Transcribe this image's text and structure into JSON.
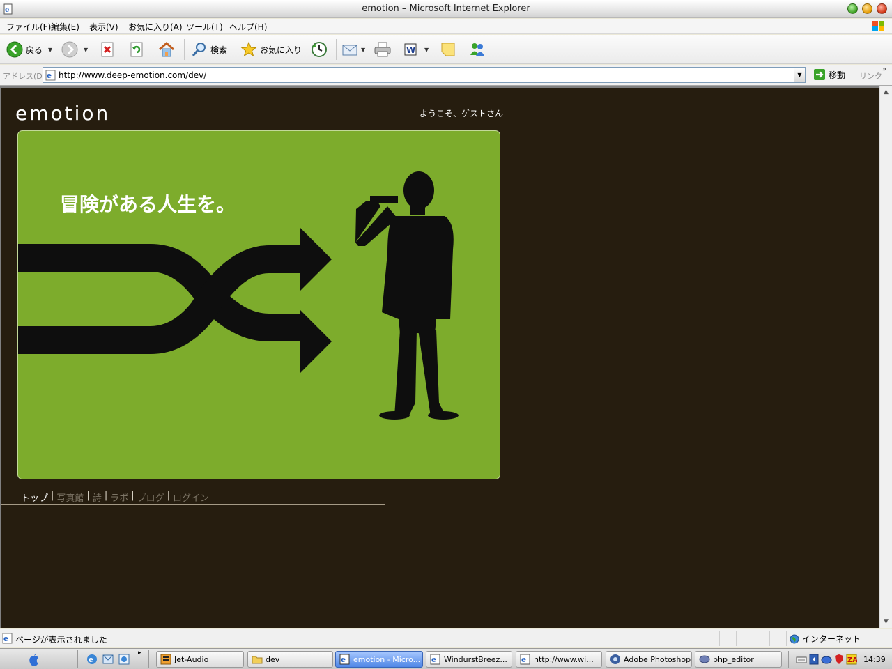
{
  "window": {
    "title": "emotion – Microsoft Internet Explorer"
  },
  "menu": {
    "items": [
      "ファイル(F)",
      "編集(E)",
      "表示(V)",
      "お気に入り(A)",
      "ツール(T)",
      "ヘルプ(H)"
    ]
  },
  "toolbar": {
    "back_label": "戻る",
    "search_label": "検索",
    "favorites_label": "お気に入り",
    "icons": [
      "back-icon",
      "forward-icon",
      "stop-icon",
      "refresh-icon",
      "home-icon",
      "search-icon",
      "favorites-icon",
      "history-icon",
      "mail-icon",
      "print-icon",
      "edit-icon",
      "discuss-icon",
      "messenger-icon"
    ]
  },
  "address": {
    "label": "アドレス(D)",
    "url": "http://www.deep-emotion.com/dev/",
    "go_label": "移動",
    "links_label": "リンク",
    "links_chevron": "»"
  },
  "page": {
    "logo": "emotion",
    "welcome": "ようこそ、ゲストさん",
    "hero_copy": "冒険がある人生を。",
    "nav": [
      {
        "label": "トップ",
        "active": true
      },
      {
        "label": "写真館",
        "active": false
      },
      {
        "label": "詩",
        "active": false
      },
      {
        "label": "ラボ",
        "active": false
      },
      {
        "label": "ブログ",
        "active": false
      },
      {
        "label": "ログイン",
        "active": false
      }
    ],
    "nav_separator": "|",
    "colors": {
      "background": "#261d0f",
      "hero": "#7dac2c"
    }
  },
  "status": {
    "text": "ページが表示されました",
    "zone": "インターネット"
  },
  "taskbar": {
    "quicklaunch_chevron": "▸",
    "tasks": [
      {
        "label": "Jet-Audio",
        "active": false,
        "icon": "jetaudio-icon"
      },
      {
        "label": "dev",
        "active": false,
        "icon": "folder-icon"
      },
      {
        "label": "emotion - Micro...",
        "active": true,
        "icon": "ie-icon"
      },
      {
        "label": "WindurstBreez...",
        "active": false,
        "icon": "ie-icon"
      },
      {
        "label": "http://www.wi...",
        "active": false,
        "icon": "ie-icon"
      },
      {
        "label": "Adobe Photoshop",
        "active": false,
        "icon": "photoshop-icon"
      },
      {
        "label": "php_editor",
        "active": false,
        "icon": "php-icon"
      }
    ],
    "clock": "14:39"
  }
}
